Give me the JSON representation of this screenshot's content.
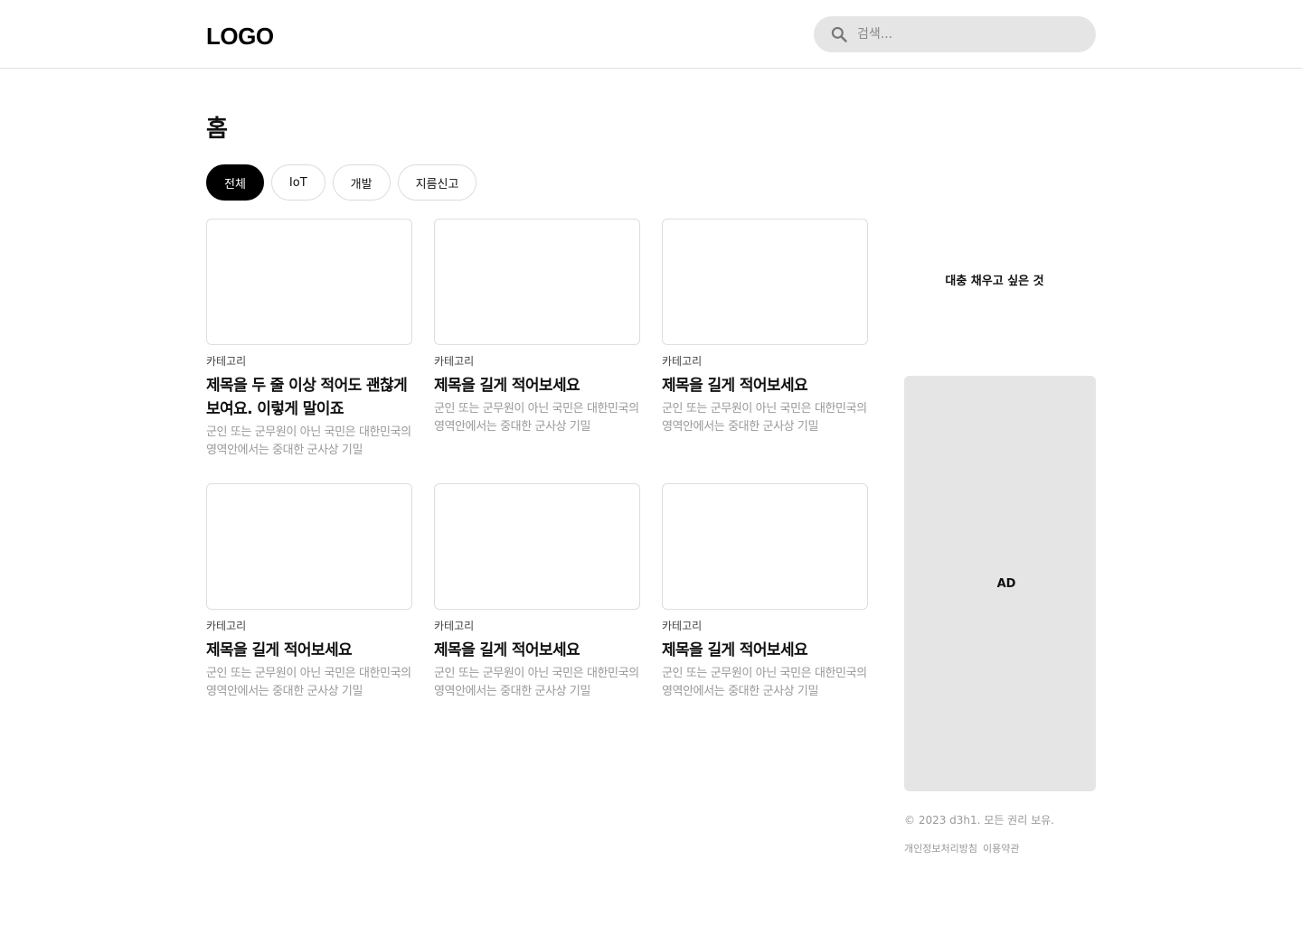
{
  "header": {
    "logo": "LOGO",
    "search_placeholder": "검색..."
  },
  "page_title": "홈",
  "tabs": [
    {
      "label": "전체",
      "active": true
    },
    {
      "label": "IoT",
      "active": false
    },
    {
      "label": "개발",
      "active": false
    },
    {
      "label": "지름신고",
      "active": false
    }
  ],
  "cards": [
    {
      "category": "카테고리",
      "title": "제목을 두 줄 이상 적어도 괜찮게 보여요. 이렇게 말이죠",
      "description": "군인 또는 군무원이 아닌 국민은 대한민국의 영역안에서는 중대한 군사상 기밀"
    },
    {
      "category": "카테고리",
      "title": "제목을 길게 적어보세요",
      "description": "군인 또는 군무원이 아닌 국민은 대한민국의 영역안에서는 중대한 군사상 기밀"
    },
    {
      "category": "카테고리",
      "title": "제목을 길게 적어보세요",
      "description": "군인 또는 군무원이 아닌 국민은 대한민국의 영역안에서는 중대한 군사상 기밀"
    },
    {
      "category": "카테고리",
      "title": "제목을 길게 적어보세요",
      "description": "군인 또는 군무원이 아닌 국민은 대한민국의 영역안에서는 중대한 군사상 기밀"
    },
    {
      "category": "카테고리",
      "title": "제목을 길게 적어보세요",
      "description": "군인 또는 군무원이 아닌 국민은 대한민국의 영역안에서는 중대한 군사상 기밀"
    },
    {
      "category": "카테고리",
      "title": "제목을 길게 적어보세요",
      "description": "군인 또는 군무원이 아닌 국민은 대한민국의 영역안에서는 중대한 군사상 기밀"
    }
  ],
  "sidebar": {
    "note": "대충 채우고 싶은 것",
    "ad_label": "AD"
  },
  "footer": {
    "copyright": "© 2023 d3h1. 모든 권리 보유.",
    "links": [
      "개인정보처리방침",
      "이용약관"
    ]
  },
  "colors": {
    "accent": "#000000",
    "surface": "#e5e5e5",
    "muted_text": "#999999"
  }
}
